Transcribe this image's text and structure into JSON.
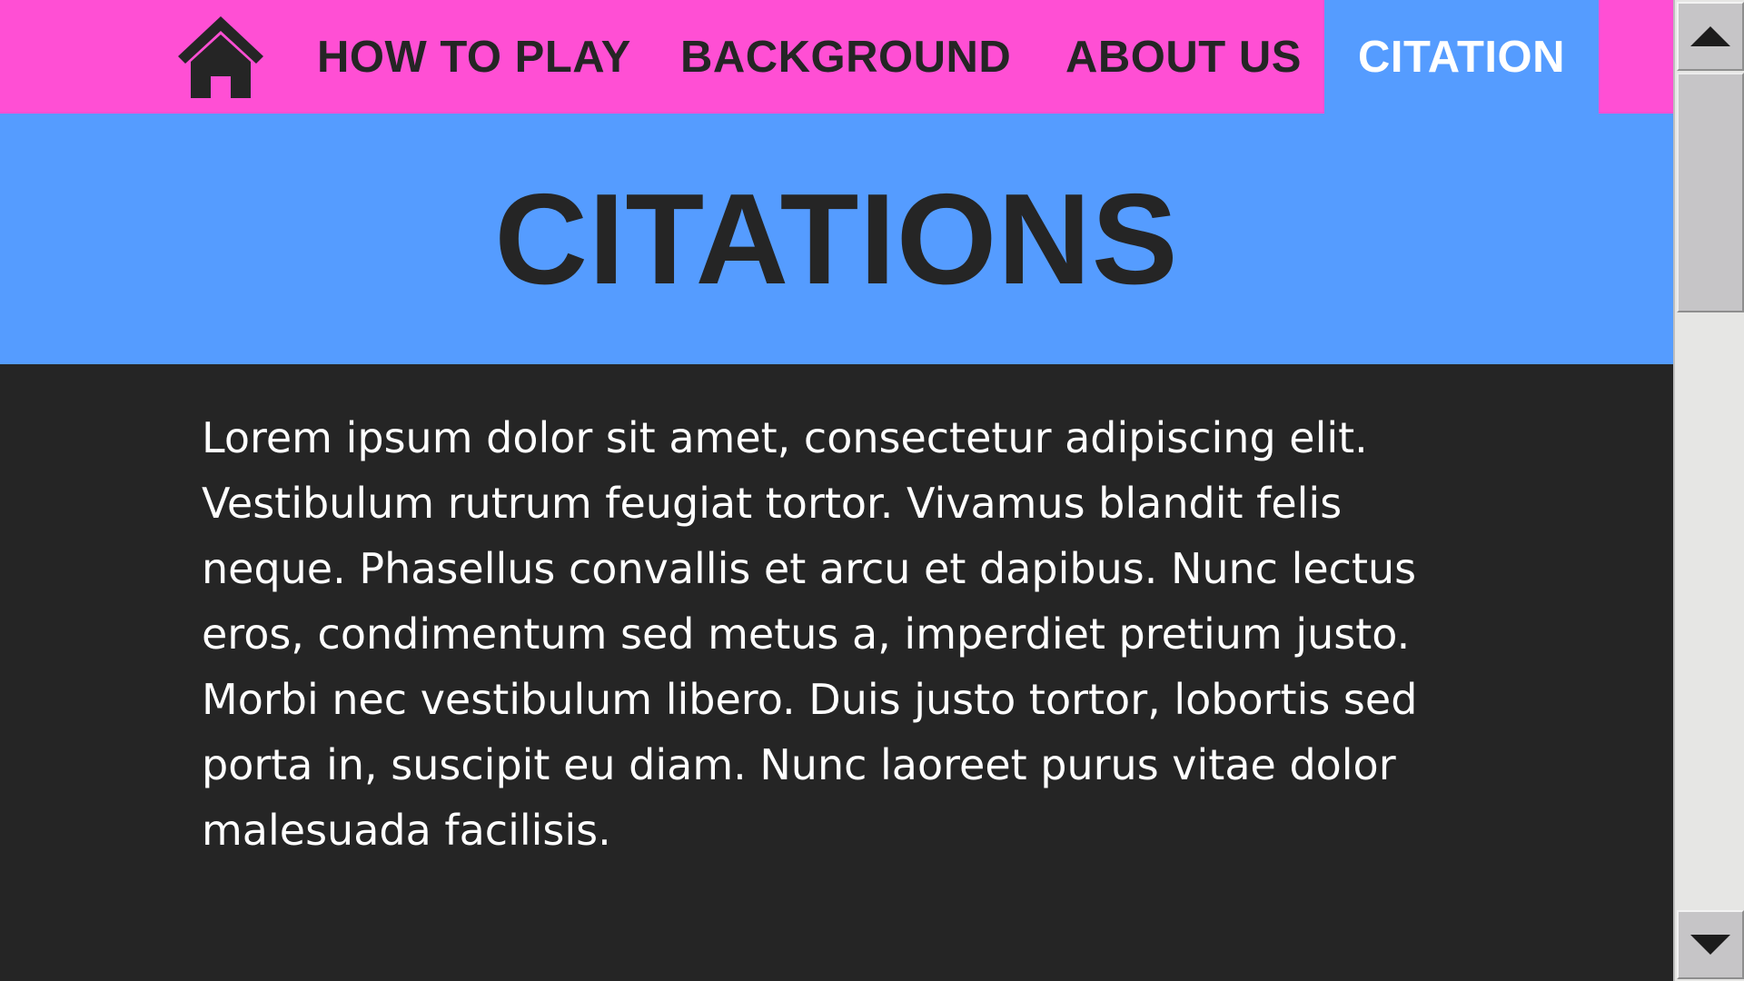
{
  "nav": {
    "home_icon": "home-icon",
    "items": [
      {
        "label": "HOW TO PLAY"
      },
      {
        "label": "BACKGROUND"
      },
      {
        "label": "ABOUT US"
      },
      {
        "label": "CITATION",
        "active": true
      }
    ]
  },
  "hero": {
    "title": "CITATIONS"
  },
  "content": {
    "paragraph": "Lorem ipsum dolor sit amet, consectetur adipiscing elit. Vestibulum rutrum feugiat tortor. Vivamus blandit felis neque. Phasellus convallis et arcu et dapibus. Nunc lectus eros, condimentum sed metus a, imperdiet pretium justo. Morbi nec vestibulum libero. Duis justo tortor, lobortis sed porta in, suscipit eu diam. Nunc laoreet purus vitae dolor malesuada facilisis."
  },
  "scrollbar": {
    "up_icon": "arrow-up-icon",
    "down_icon": "arrow-down-icon"
  },
  "colors": {
    "nav_bg": "#ff4fd4",
    "hero_bg": "#559cff",
    "active_tab_bg": "#559cff",
    "page_bg": "#252525",
    "text_dark": "#252525",
    "text_light": "#ffffff"
  }
}
